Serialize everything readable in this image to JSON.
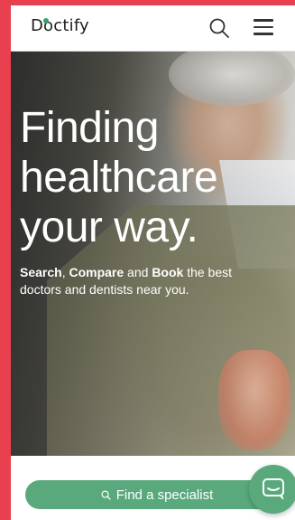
{
  "header": {
    "logo_text": "Doctify",
    "search_icon": "search-icon",
    "menu_icon": "hamburger-menu-icon"
  },
  "hero": {
    "headline_lines": [
      "Finding",
      "healthcare",
      "your way."
    ],
    "sub_parts": [
      "Search",
      ", ",
      "Compare",
      " and ",
      "Book",
      " the best doctors and dentists near you."
    ]
  },
  "cta": {
    "label": "Find a specialist",
    "icon": "search-icon"
  },
  "chat": {
    "icon": "chat-bubble-icon"
  },
  "colors": {
    "accent": "#5aa97d",
    "frame": "#e8404e",
    "logo_dot": "#2fa36b"
  }
}
